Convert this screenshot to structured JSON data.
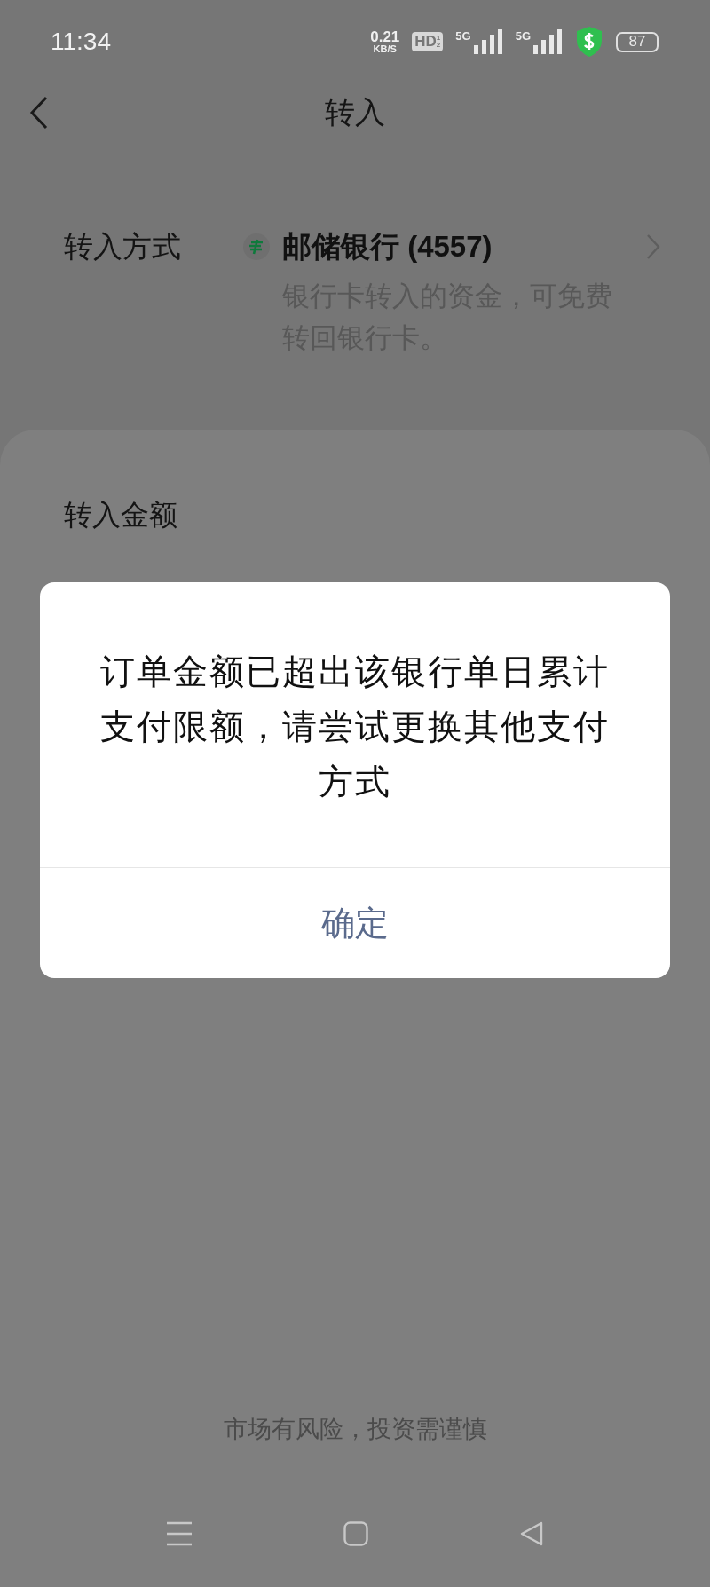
{
  "status_bar": {
    "time": "11:34",
    "net_speed": "0.21",
    "net_unit": "KB/S",
    "hd_label": "HD",
    "hd_sub_1": "1",
    "hd_sub_2": "2",
    "signals": [
      {
        "label": "5G"
      },
      {
        "label": "5G"
      }
    ],
    "battery": "87"
  },
  "header": {
    "title": "转入"
  },
  "transfer_method": {
    "label": "转入方式",
    "bank": "邮储银行 (4557)",
    "note": "银行卡转入的资金，可免费转回银行卡。"
  },
  "amount_section": {
    "label": "转入金额"
  },
  "dialog": {
    "message": "订单金额已超出该银行单日累计支付限额，请尝试更换其他支付方式",
    "button": "确定"
  },
  "footer": {
    "disclaimer": "市场有风险，投资需谨慎"
  }
}
